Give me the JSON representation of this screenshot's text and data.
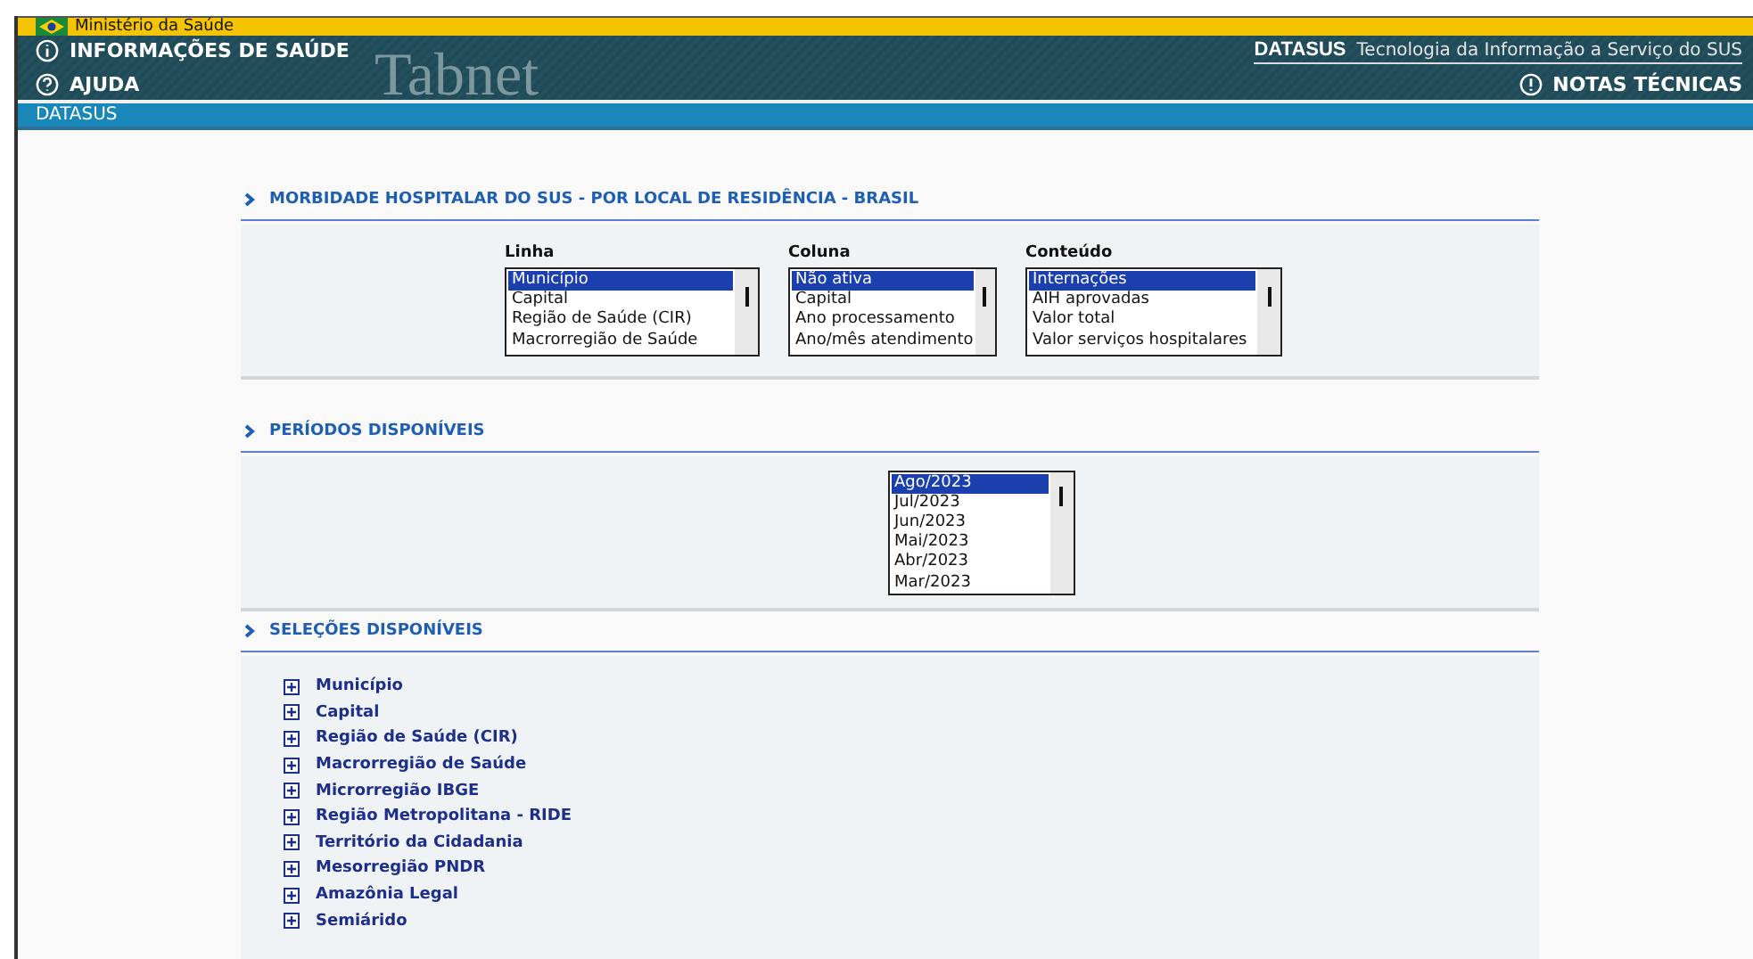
{
  "top_bar": {
    "title": "Ministério da Saúde"
  },
  "header": {
    "logo_text": "Tabnet",
    "links_left": [
      "INFORMAÇÕES DE SAÚDE",
      "AJUDA"
    ],
    "brand": "DATASUS",
    "tagline": "Tecnologia da Informação a Serviço do SUS",
    "link_right": "NOTAS TÉCNICAS"
  },
  "nav_bar": {
    "label": "DATASUS"
  },
  "sections": [
    {
      "kind": "selectors",
      "title": "MORBIDADE HOSPITALAR DO SUS - POR LOCAL DE RESIDÊNCIA - BRASIL",
      "lists": [
        {
          "label": "Linha",
          "options": [
            {
              "text": "Município",
              "selected": true
            },
            {
              "text": "Capital",
              "selected": false
            },
            {
              "text": "Região de Saúde (CIR)",
              "selected": false
            },
            {
              "text": "Macrorregião de Saúde",
              "selected": false
            }
          ]
        },
        {
          "label": "Coluna",
          "options": [
            {
              "text": "Não ativa",
              "selected": true
            },
            {
              "text": "Capital",
              "selected": false
            },
            {
              "text": "Ano processamento",
              "selected": false
            },
            {
              "text": "Ano/mês atendimento",
              "selected": false
            }
          ]
        },
        {
          "label": "Conteúdo",
          "options": [
            {
              "text": "Internações",
              "selected": true
            },
            {
              "text": "AIH aprovadas",
              "selected": false
            },
            {
              "text": "Valor total",
              "selected": false
            },
            {
              "text": "Valor serviços hospitalares",
              "selected": false
            }
          ]
        }
      ]
    },
    {
      "kind": "periods",
      "title": "PERÍODOS DISPONÍVEIS",
      "options": [
        {
          "text": "Ago/2023",
          "selected": true
        },
        {
          "text": "Jul/2023",
          "selected": false
        },
        {
          "text": "Jun/2023",
          "selected": false
        },
        {
          "text": "Mai/2023",
          "selected": false
        },
        {
          "text": "Abr/2023",
          "selected": false
        },
        {
          "text": "Mar/2023",
          "selected": false
        }
      ]
    },
    {
      "kind": "filters",
      "title": "SELEÇÕES DISPONÍVEIS",
      "items": [
        {
          "label": "Município"
        },
        {
          "label": "Capital"
        },
        {
          "label": "Região de Saúde (CIR)"
        },
        {
          "label": "Macrorregião de Saúde"
        },
        {
          "label": "Microrregião IBGE"
        },
        {
          "label": "Região Metropolitana - RIDE"
        },
        {
          "label": "Território da Cidadania"
        },
        {
          "label": "Mesorregião PNDR"
        },
        {
          "label": "Amazônia Legal"
        },
        {
          "label": "Semiárido"
        }
      ]
    }
  ]
}
